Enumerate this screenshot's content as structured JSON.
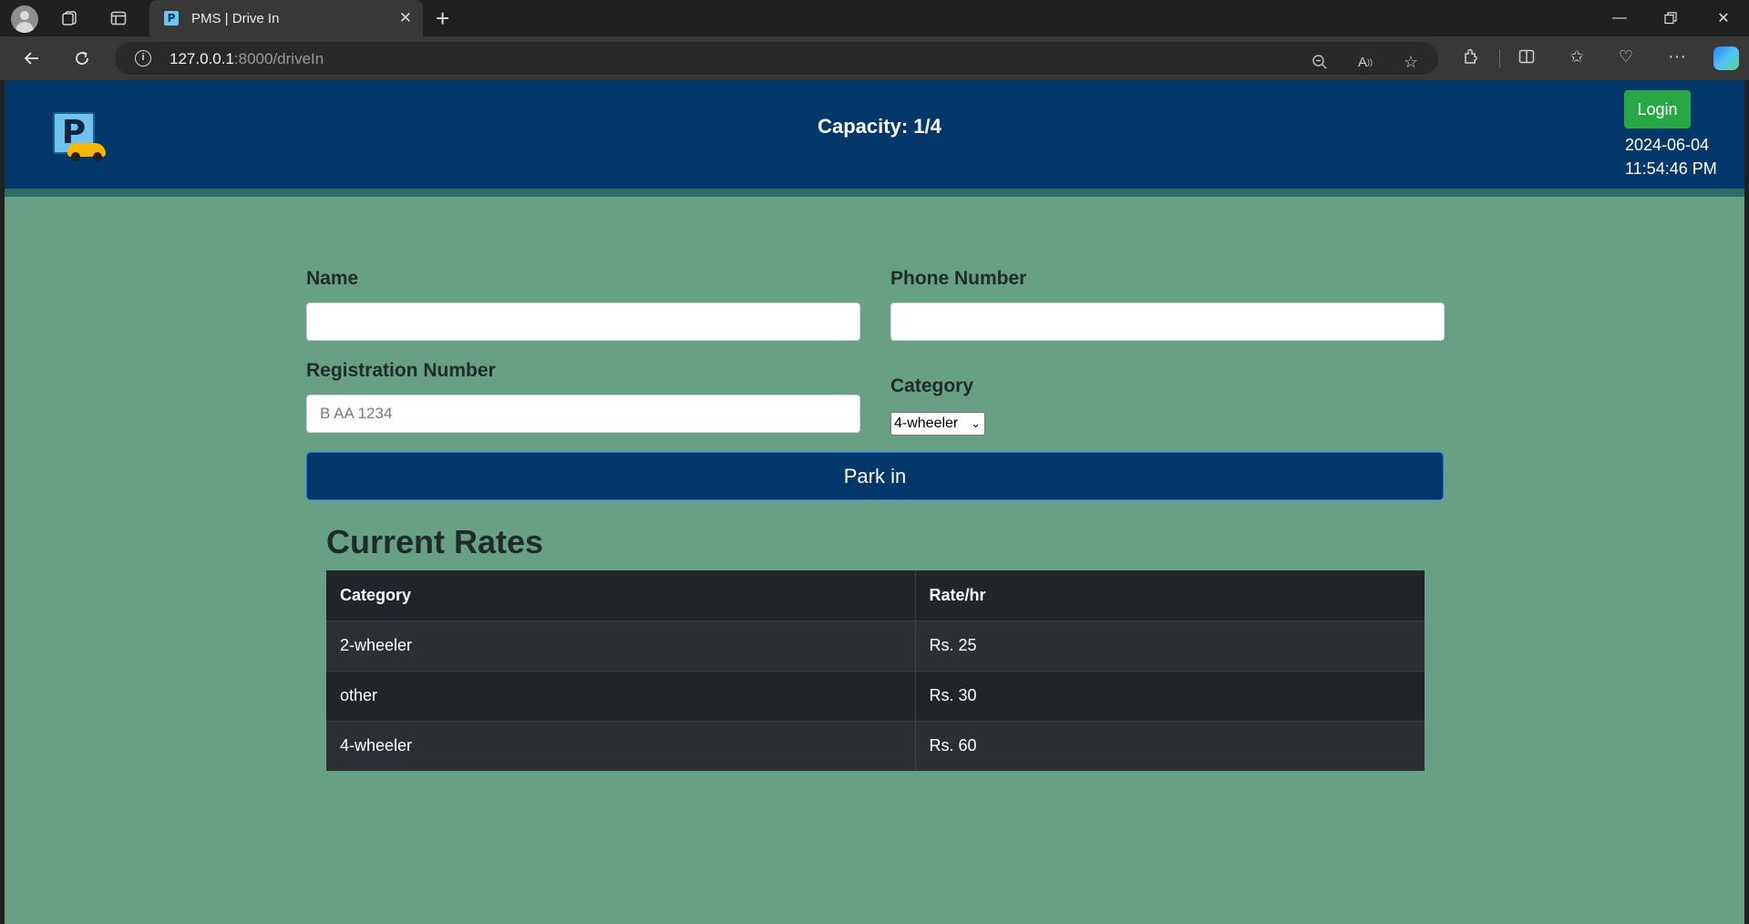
{
  "browser": {
    "tab_title": "PMS | Drive In",
    "tab_favicon": "P",
    "url_host": "127.0.0.1",
    "url_rest": ":8000/driveIn"
  },
  "header": {
    "capacity": "Capacity: 1/4",
    "login_label": "Login",
    "date": "2024-06-04",
    "time": "11:54:46 PM",
    "logo_letter": "P"
  },
  "form": {
    "name_label": "Name",
    "name_value": "",
    "phone_label": "Phone Number",
    "phone_value": "",
    "registration_label": "Registration Number",
    "registration_placeholder": "B AA 1234",
    "category_label": "Category",
    "category_selected": "4-wheeler",
    "submit_label": "Park in"
  },
  "rates": {
    "title": "Current Rates",
    "columns": [
      "Category",
      "Rate/hr"
    ],
    "rows": [
      {
        "category": "2-wheeler",
        "rate": "Rs. 25"
      },
      {
        "category": "other",
        "rate": "Rs. 30"
      },
      {
        "category": "4-wheeler",
        "rate": "Rs. 60"
      }
    ]
  },
  "colors": {
    "header_bg": "#04376a",
    "page_bg": "#68a085",
    "login_green": "#28a745"
  }
}
